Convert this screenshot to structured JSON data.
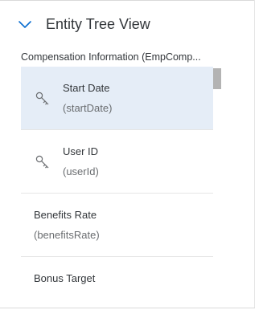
{
  "header": {
    "title": "Entity Tree View",
    "chevron_icon": "chevron-down-icon",
    "accent_color": "#0a6ed1"
  },
  "entity": {
    "label": "Compensation Information (EmpComp..."
  },
  "fields": [
    {
      "name": "Start Date",
      "technical": "(startDate)",
      "icon": "key-icon",
      "selected": true
    },
    {
      "name": "User ID",
      "technical": "(userId)",
      "icon": "key-icon",
      "selected": false
    },
    {
      "name": "Benefits Rate",
      "technical": "(benefitsRate)",
      "icon": "",
      "selected": false
    },
    {
      "name": "Bonus Target",
      "technical": "",
      "icon": "",
      "selected": false
    }
  ],
  "colors": {
    "selected_row": "#e5edf7",
    "text": "#32363a",
    "secondary_text": "#6a6d70",
    "scroll_thumb": "#b3b3b3"
  }
}
